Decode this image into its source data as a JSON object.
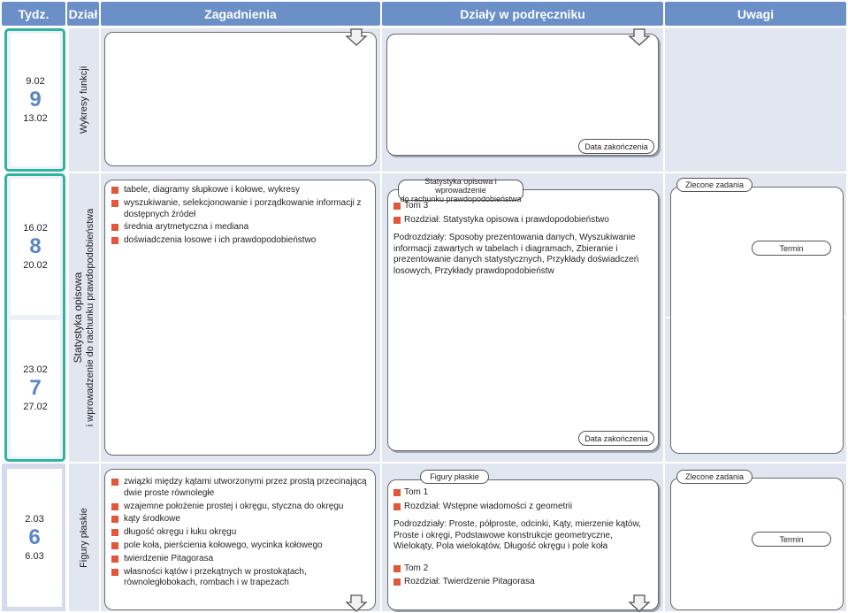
{
  "header": {
    "week": "Tydz.",
    "section": "Dział",
    "topics": "Zagadnienia",
    "book_sections": "Działy w podręczniku",
    "notes": "Uwagi"
  },
  "weeks": [
    {
      "start": "9.02",
      "num": "9",
      "end": "13.02"
    },
    {
      "start": "16.02",
      "num": "8",
      "end": "20.02"
    },
    {
      "start": "23.02",
      "num": "7",
      "end": "27.02"
    },
    {
      "start": "2.03",
      "num": "6",
      "end": "6.03"
    }
  ],
  "sections": {
    "s1": "Wykresy funkcji",
    "s2_line1": "Statystyka opisowa",
    "s2_line2": "i wprowadzenie do rachunku prawdopodobieństwa",
    "s3": "Figury płaskie"
  },
  "labels": {
    "end_date": "Data zakończenia",
    "assigned": "Zlecone zadania",
    "deadline": "Termin"
  },
  "topics_stats": [
    "tabele, diagramy słupkowe i kołowe, wykresy",
    "wyszukiwanie, selekcjonowanie i porządkowanie informacji z dostępnych źródeł",
    "średnia arytmetyczna i mediana",
    "doświadczenia losowe i ich prawdopodobieństwo"
  ],
  "topics_figures": [
    "związki między kątami utworzonymi przez prostą przecinającą dwie proste równoległe",
    "wzajemne położenie prostej i okręgu, styczna do okręgu",
    "kąty środkowe",
    "długość okręgu i łuku okręgu",
    "pole koła, pierścienia kołowego, wycinka kołowego",
    "twierdzenie Pitagorasa",
    "własności kątów i przekątnych w prostokątach, równoległobokach, rombach i w trapezach"
  ],
  "book_stats": {
    "tag_line1": "Statystyka opisowa i wprowadzenie",
    "tag_line2": "do rachunku prawdopodobieństwa",
    "volume": "Tom 3",
    "chapter": "Rozdział: Statystyka opisowa i prawdopodobieństwo",
    "subsections": "Podrozdziały: Sposoby prezentowania danych, Wyszukiwanie informacji zawartych w tabelach i diagramach, Zbieranie i prezentowanie danych statystycznych, Przykłady doświadczeń losowych, Przykłady prawdopodobieństw"
  },
  "book_figures": {
    "tag": "Figury płaskie",
    "volume1": "Tom 1",
    "chapter1": "Rozdział: Wstępne wiadomości z geometrii",
    "subsections1": "Podrozdziały: Proste, półproste, odcinki, Kąty, mierzenie kątów, Proste i okręgi, Podstawowe konstrukcje geometryczne, Wielokąty, Pola wielokątów, Długość okręgu i pole koła",
    "volume2": "Tom 2",
    "chapter2": "Rozdział: Twierdzenie Pitagorasa"
  }
}
